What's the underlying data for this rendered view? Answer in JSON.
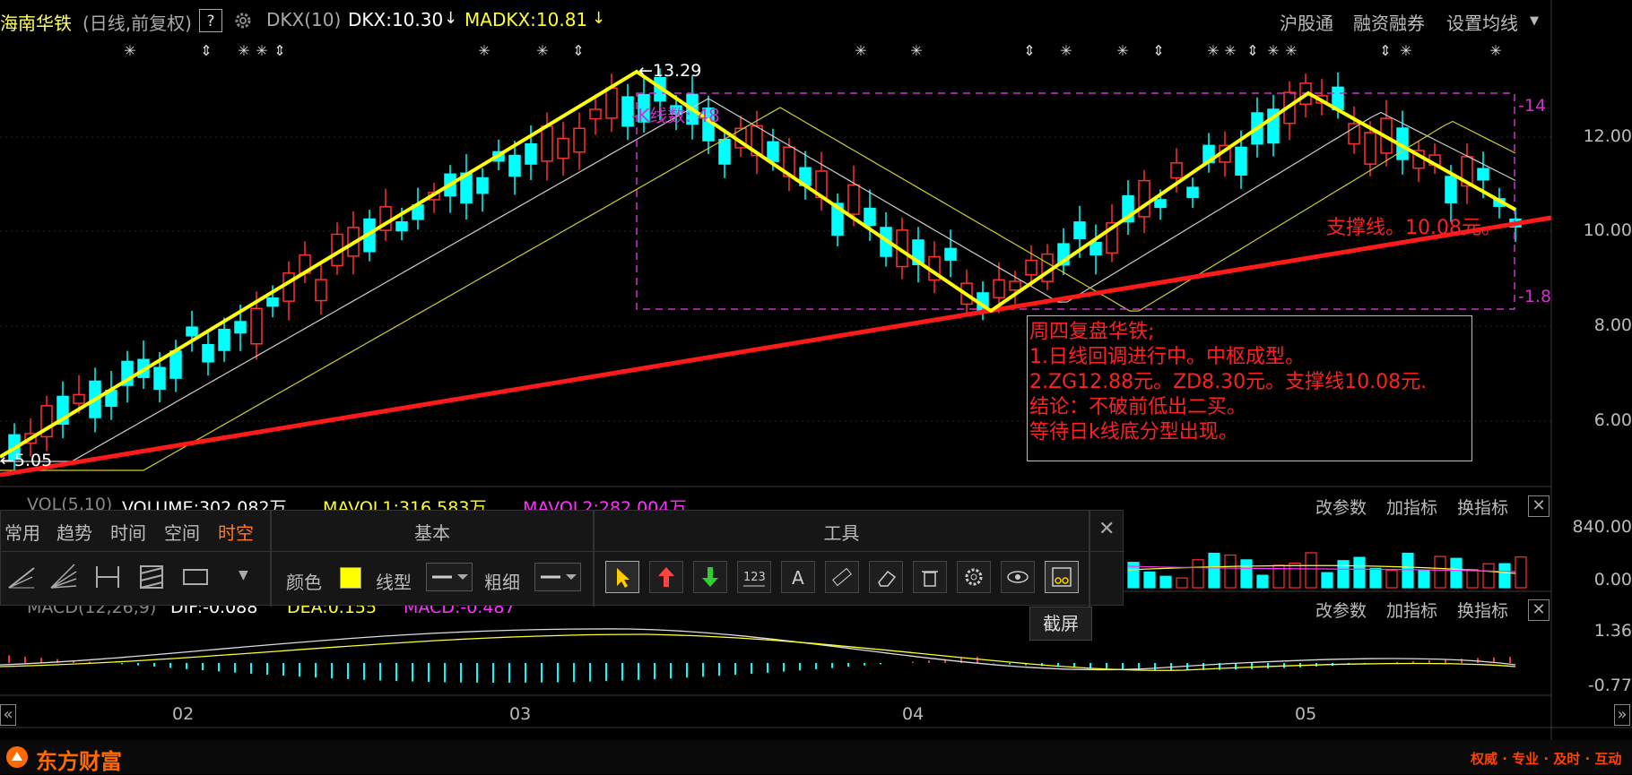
{
  "header": {
    "stock_name": "海南华铁",
    "period": "(日线,前复权)",
    "help": "?",
    "indicator_name": "DKX(10)",
    "dkx_value": "DKX:10.30",
    "madkx_value": "MADKX:10.81",
    "links": [
      "沪股通",
      "融资融券",
      "设置均线"
    ]
  },
  "chart": {
    "price_labels": [
      "12.00",
      "10.00",
      "8.00",
      "6.00"
    ],
    "high_marker": "13.29",
    "low_marker": "5.05",
    "kline_count_label": "K线数",
    "kline_count": "48",
    "box_top_label": "-14",
    "box_bottom_label": "-1.8",
    "support_label": "支撑线。10.08元。",
    "colors": {
      "up": "#ff3030",
      "down": "#00ffff",
      "zigzag": "#ffff00",
      "support": "#ff1a1a",
      "box": "#cc33cc"
    }
  },
  "annotation": {
    "lines": [
      "周四复盘华铁;",
      "1.日线回调进行中。中枢成型。",
      "2.ZG12.88元。ZD8.30元。支撑线10.08元.",
      "结论：不破前低出二买。",
      "等待日k线底分型出现。"
    ]
  },
  "volume": {
    "title": "VOL(5,10)",
    "volume": "VOLUME:302,082万",
    "mavol1": "MAVOL1:316,583万",
    "mavol2": "MAVOL2:282,004万",
    "axis": [
      "840.00",
      "0.00"
    ],
    "buttons": [
      "改参数",
      "加指标",
      "换指标"
    ],
    "close": "✕"
  },
  "macd": {
    "title": "MACD(12,26,9)",
    "dif": "DIF:-0.088",
    "dea": "DEA:0.155",
    "macd": "MACD:-0.487",
    "axis": [
      "1.36",
      "-0.77"
    ],
    "buttons": [
      "改参数",
      "加指标",
      "换指标"
    ],
    "close": "✕"
  },
  "toolbar": {
    "tabs": [
      "常用",
      "趋势",
      "时间",
      "空间",
      "时空"
    ],
    "active_tab": "时空",
    "section_basic": "基本",
    "section_tools": "工具",
    "color_label": "颜色",
    "color_value": "#ffff00",
    "line_type_label": "线型",
    "thickness_label": "粗细",
    "tooltip": "截屏",
    "close": "✕"
  },
  "xaxis": {
    "labels": [
      "02",
      "03",
      "04",
      "05"
    ]
  },
  "footer": {
    "brand": "东方财富",
    "slogan": "权威 · 专业 · 及时 · 互动"
  }
}
